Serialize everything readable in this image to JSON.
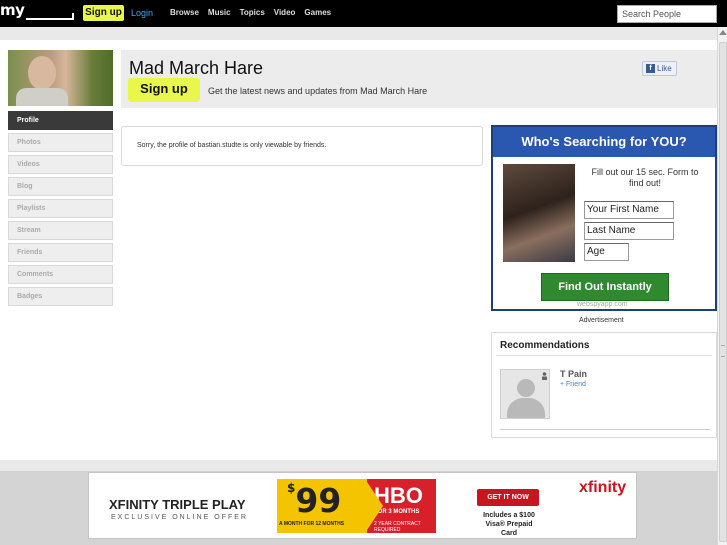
{
  "topbar": {
    "logo": "my",
    "signup_label": "Sign up",
    "login_label": "Login",
    "nav": [
      "Browse",
      "Music",
      "Topics",
      "Video",
      "Games"
    ],
    "search_placeholder": "Search People"
  },
  "profile": {
    "name": "Mad March Hare",
    "signup_label": "Sign up",
    "tagline": "Get the latest news and updates from Mad March Hare",
    "like_label": "Like",
    "private_message": "Sorry, the profile of bastian.studte is only viewable by friends."
  },
  "sidebar": {
    "items": [
      {
        "label": "Profile",
        "active": true
      },
      {
        "label": "Photos"
      },
      {
        "label": "Videos"
      },
      {
        "label": "Blog"
      },
      {
        "label": "Playlists"
      },
      {
        "label": "Stream"
      },
      {
        "label": "Friends"
      },
      {
        "label": "Comments"
      },
      {
        "label": "Badges"
      }
    ]
  },
  "ad": {
    "headline": "Who's Searching for YOU?",
    "body": "Fill out our 15 sec. Form to find out!",
    "field_first_name": "Your First Name",
    "field_last_name": "Last Name",
    "field_age": "Age",
    "cta": "Find Out Instantly",
    "domain": "webspyapp.com",
    "label": "Advertisement"
  },
  "recommendations": {
    "title": "Recommendations",
    "items": [
      {
        "name": "T Pain",
        "action": "+ Friend"
      }
    ]
  },
  "banner": {
    "title": "XFINITY TRIPLE PLAY",
    "subtitle": "EXCLUSIVE ONLINE OFFER",
    "price": "99",
    "price_symbol": "$",
    "price_note": "A MONTH FOR 12 MONTHS",
    "hbo": "HBO",
    "hbo_note": "FOR 3 MONTHS",
    "contract_note": "2 YEAR CONTRACT REQUIRED",
    "cta": "GET IT NOW",
    "includes": "Includes a $100 Visa® Prepaid Card",
    "brand": "xfinity"
  },
  "colors": {
    "accent_yellow": "#e9f74b",
    "link_blue": "#3fa7e8",
    "ad_blue": "#2a57b0",
    "cta_green": "#2f8a2f"
  }
}
